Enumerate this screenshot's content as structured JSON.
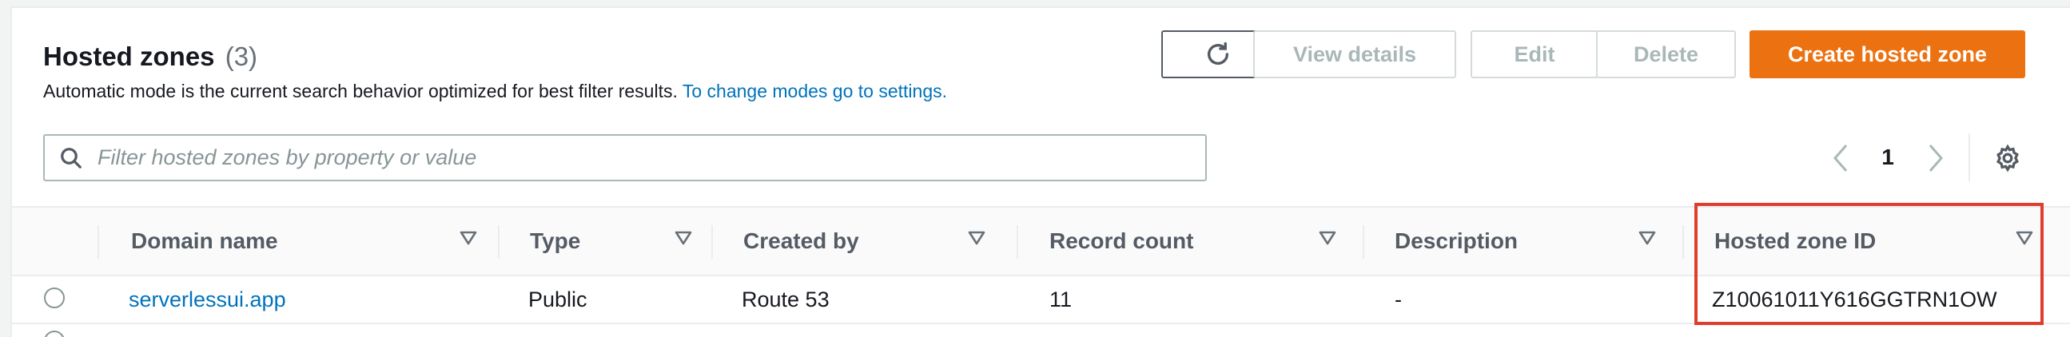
{
  "header": {
    "title": "Hosted zones",
    "count": "(3)",
    "subtitle": "Automatic mode is the current search behavior optimized for best filter results.",
    "subtitle_link": "To change modes go to settings."
  },
  "toolbar": {
    "refresh_icon": "refresh-icon",
    "view_details": "View details",
    "edit": "Edit",
    "delete": "Delete",
    "create": "Create hosted zone"
  },
  "search": {
    "placeholder": "Filter hosted zones by property or value",
    "icon": "search-icon"
  },
  "pagination": {
    "current_page": "1"
  },
  "table": {
    "columns": [
      "Domain name",
      "Type",
      "Created by",
      "Record count",
      "Description",
      "Hosted zone ID"
    ],
    "rows": [
      {
        "domain": "serverlessui.app",
        "type": "Public",
        "created_by": "Route 53",
        "record_count": "11",
        "description": "-",
        "hosted_zone_id": "Z10061011Y616GGTRN1OW"
      }
    ]
  },
  "colors": {
    "primary": "#ec7211",
    "link": "#0073bb",
    "highlight": "#e03d2e"
  }
}
